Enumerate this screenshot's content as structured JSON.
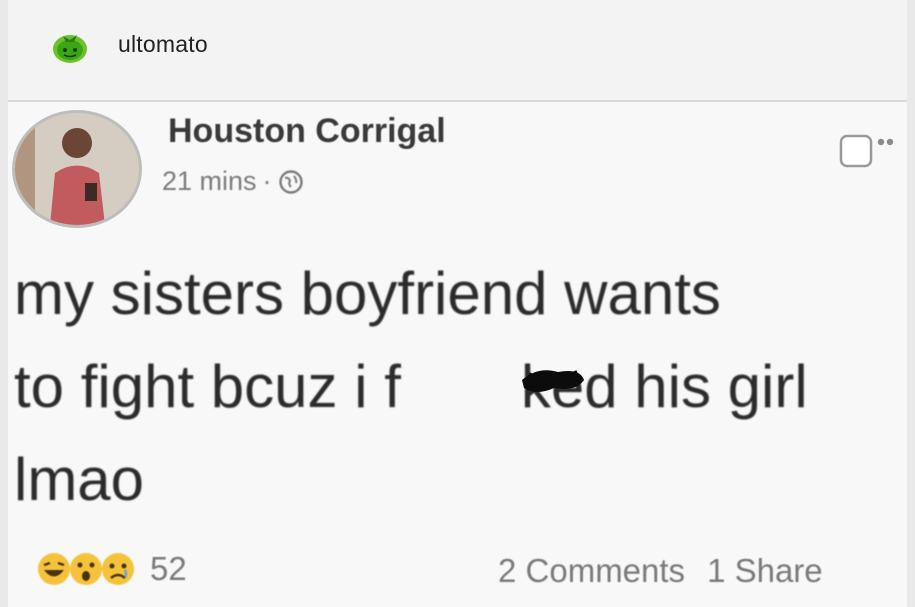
{
  "app": {
    "name": "ultomato",
    "logo_icon": "tomato-logo-icon"
  },
  "post": {
    "author": "Houston Corrigal",
    "time": "21 mins",
    "separator": "·",
    "privacy_icon": "globe-icon",
    "text": "my sisters boyfriend wants\nto fight bcuz i f  ked his girl\nlmao",
    "reactions": {
      "icons": [
        "haha-icon",
        "wow-icon",
        "sad-icon"
      ],
      "count": "52"
    },
    "comments": "2 Comments",
    "shares": "1 Share"
  },
  "colors": {
    "reaction_yellow": "#f5c33b",
    "text": "#2b2b2b",
    "muted": "#7a7a7a"
  }
}
